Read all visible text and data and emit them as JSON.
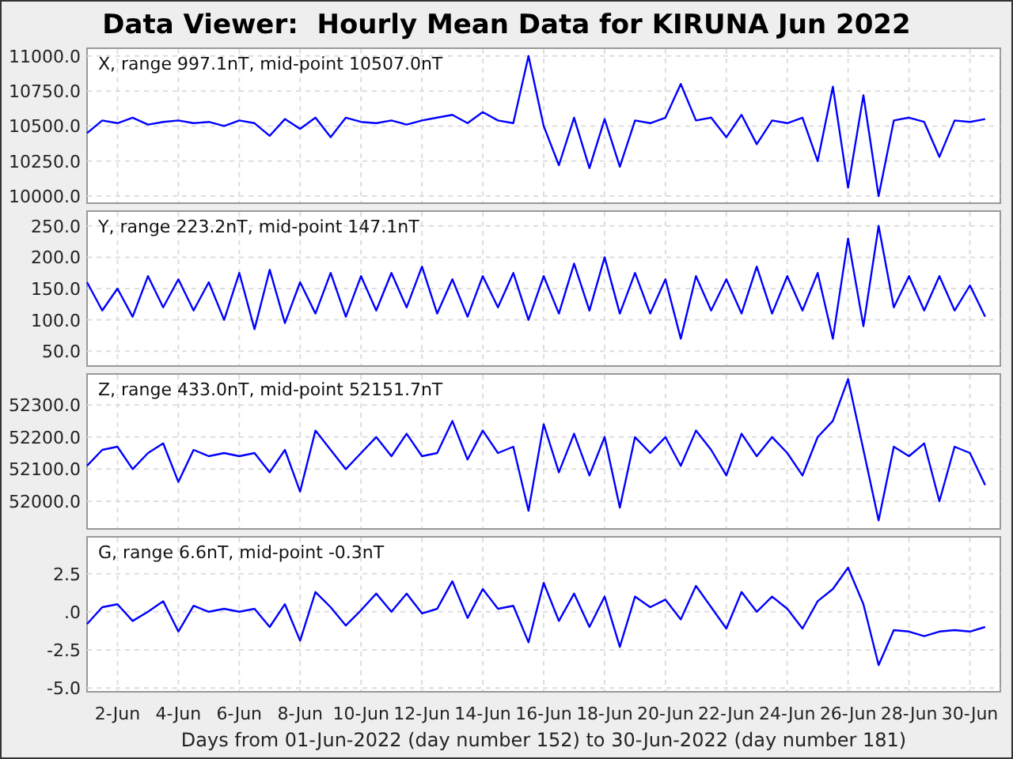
{
  "title": "Data Viewer:  Hourly Mean Data for KIRUNA Jun 2022",
  "panels": [
    {
      "chart_data": {
        "type": "line",
        "grid": true,
        "title": "X, range 997.1nT, mid-point 10507.0nT",
        "ylim": [
          9955,
          11050
        ],
        "yticks": [
          {
            "value": 11000,
            "label": "11000.0"
          },
          {
            "value": 10750,
            "label": "10750.0"
          },
          {
            "value": 10500,
            "label": "10500.0"
          },
          {
            "value": 10250,
            "label": "10250.0"
          },
          {
            "value": 10000,
            "label": "10000.0"
          }
        ],
        "series": [
          {
            "color": "#0000ff",
            "values": [
              10450,
              10540,
              10520,
              10560,
              10510,
              10530,
              10540,
              10520,
              10530,
              10500,
              10540,
              10520,
              10430,
              10550,
              10480,
              10560,
              10420,
              10560,
              10530,
              10520,
              10540,
              10510,
              10540,
              10560,
              10580,
              10520,
              10600,
              10540,
              10520,
              11000,
              10500,
              10220,
              10560,
              10200,
              10550,
              10210,
              10540,
              10520,
              10560,
              10800,
              10540,
              10560,
              10420,
              10580,
              10370,
              10540,
              10520,
              10560,
              10250,
              10780,
              10060,
              10720,
              10000,
              10540,
              10560,
              10530,
              10280,
              10540,
              10530,
              10550
            ]
          }
        ]
      }
    },
    {
      "chart_data": {
        "type": "line",
        "grid": true,
        "title": "Y, range 223.2nT, mid-point 147.1nT",
        "ylim": [
          27.5,
          272.5
        ],
        "yticks": [
          {
            "value": 250,
            "label": "250.0"
          },
          {
            "value": 200,
            "label": "200.0"
          },
          {
            "value": 150,
            "label": "150.0"
          },
          {
            "value": 100,
            "label": "100.0"
          },
          {
            "value": 50,
            "label": "50.0"
          }
        ],
        "series": [
          {
            "color": "#0000ff",
            "values": [
              160,
              115,
              150,
              105,
              170,
              120,
              165,
              115,
              160,
              100,
              175,
              85,
              180,
              95,
              160,
              110,
              175,
              105,
              170,
              115,
              175,
              120,
              185,
              110,
              165,
              105,
              170,
              120,
              175,
              100,
              170,
              110,
              190,
              115,
              200,
              110,
              175,
              110,
              165,
              70,
              170,
              115,
              165,
              110,
              185,
              110,
              170,
              115,
              175,
              70,
              230,
              90,
              250,
              120,
              170,
              115,
              170,
              115,
              155,
              105
            ]
          }
        ]
      }
    },
    {
      "chart_data": {
        "type": "line",
        "grid": true,
        "title": "Z, range 433.0nT, mid-point 52151.7nT",
        "ylim": [
          51916,
          52394
        ],
        "yticks": [
          {
            "value": 52300,
            "label": "52300.0"
          },
          {
            "value": 52200,
            "label": "52200.0"
          },
          {
            "value": 52100,
            "label": "52100.0"
          },
          {
            "value": 52000,
            "label": "52000.0"
          }
        ],
        "series": [
          {
            "color": "#0000ff",
            "values": [
              52110,
              52160,
              52170,
              52100,
              52150,
              52180,
              52060,
              52160,
              52140,
              52150,
              52140,
              52150,
              52090,
              52160,
              52030,
              52220,
              52160,
              52100,
              52150,
              52200,
              52140,
              52210,
              52140,
              52150,
              52250,
              52130,
              52220,
              52150,
              52170,
              51970,
              52240,
              52090,
              52210,
              52080,
              52200,
              51980,
              52200,
              52150,
              52200,
              52110,
              52220,
              52160,
              52080,
              52210,
              52140,
              52200,
              52150,
              52080,
              52200,
              52250,
              52380,
              52160,
              51940,
              52170,
              52140,
              52180,
              52000,
              52170,
              52150,
              52050
            ]
          }
        ]
      }
    },
    {
      "chart_data": {
        "type": "line",
        "grid": true,
        "title": "G, range 6.6nT, mid-point -0.3nT",
        "xlabel": "Days from 01-Jun-2022 (day number 152) to 30-Jun-2022 (day number 181)",
        "ylim": [
          -5.2,
          4.87
        ],
        "yticks": [
          {
            "value": 2.5,
            "label": "2.5"
          },
          {
            "value": 0,
            "label": ".0"
          },
          {
            "value": -2.5,
            "label": "-2.5"
          },
          {
            "value": -5,
            "label": "-5.0"
          }
        ],
        "categories": [
          null,
          null,
          "2-Jun",
          null,
          null,
          null,
          "4-Jun",
          null,
          null,
          null,
          "6-Jun",
          null,
          null,
          null,
          "8-Jun",
          null,
          null,
          null,
          "10-Jun",
          null,
          null,
          null,
          "12-Jun",
          null,
          null,
          null,
          "14-Jun",
          null,
          null,
          null,
          "16-Jun",
          null,
          null,
          null,
          "18-Jun",
          null,
          null,
          null,
          "20-Jun",
          null,
          null,
          null,
          "22-Jun",
          null,
          null,
          null,
          "24-Jun",
          null,
          null,
          null,
          "26-Jun",
          null,
          null,
          null,
          "28-Jun",
          null,
          null,
          null,
          "30-Jun",
          null
        ],
        "series": [
          {
            "color": "#0000ff",
            "values": [
              -0.8,
              0.3,
              0.5,
              -0.6,
              0.0,
              0.7,
              -1.3,
              0.4,
              0.0,
              0.2,
              0.0,
              0.2,
              -1.0,
              0.5,
              -1.9,
              1.3,
              0.3,
              -0.9,
              0.1,
              1.2,
              0.0,
              1.2,
              -0.1,
              0.2,
              2.0,
              -0.4,
              1.5,
              0.2,
              0.4,
              -2.0,
              1.9,
              -0.6,
              1.2,
              -1.0,
              1.0,
              -2.3,
              1.0,
              0.3,
              0.8,
              -0.5,
              1.7,
              0.3,
              -1.1,
              1.3,
              0.0,
              1.0,
              0.2,
              -1.1,
              0.7,
              1.5,
              2.9,
              0.5,
              -3.5,
              -1.2,
              -1.3,
              -1.6,
              -1.3,
              -1.2,
              -1.3,
              -1.0
            ]
          }
        ]
      }
    }
  ]
}
